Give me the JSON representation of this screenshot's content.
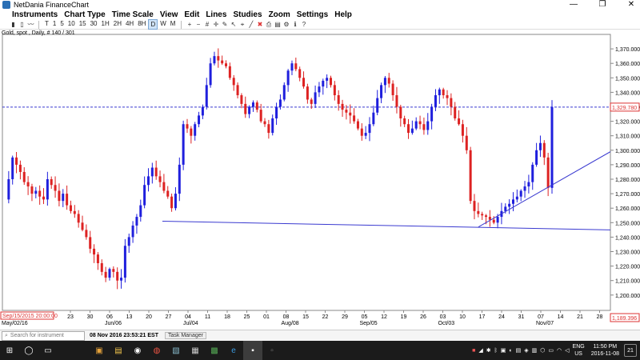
{
  "window": {
    "title": "NetDania FinanceChart",
    "controls": [
      "—",
      "❐",
      "✕"
    ]
  },
  "menu": [
    "Instruments",
    "Chart Type",
    "Time Scale",
    "View",
    "Edit",
    "Lines",
    "Studies",
    "Zoom",
    "Settings",
    "Help"
  ],
  "toolbar": {
    "periods": [
      "T",
      "1",
      "5",
      "10",
      "15",
      "30",
      "1H",
      "2H",
      "4H",
      "8H",
      "D",
      "W",
      "M"
    ],
    "active_period": "D"
  },
  "chart_label": "Gold, spot , Daily, # 140 / 301",
  "current_price_label": "1,329.780",
  "bottom_price_label": "1,189.396",
  "cursor_date_label": "Sep/15/2015 20:00:00",
  "colors": {
    "up": "#1f1fdd",
    "down": "#dd2222",
    "line": "#3a3ad0",
    "accent": "#2a6fb5"
  },
  "chart_data": {
    "type": "candlestick",
    "symbol": "Gold, spot",
    "timeframe": "Daily",
    "ylim": [
      1189.396,
      1380
    ],
    "y_ticks": [
      1200,
      1210,
      1220,
      1230,
      1240,
      1250,
      1260,
      1270,
      1280,
      1290,
      1300,
      1310,
      1320,
      1330,
      1340,
      1350,
      1360,
      1370
    ],
    "y_tick_labels": [
      "1,200.000",
      "1,210.000",
      "1,220.000",
      "1,230.000",
      "1,240.000",
      "1,250.000",
      "1,260.000",
      "1,270.000",
      "1,280.000",
      "1,290.000",
      "1,300.000",
      "1,310.000",
      "1,320.000",
      "1,330.000",
      "1,340.000",
      "1,350.000",
      "1,360.000",
      "1,370.000"
    ],
    "x_ticks": [
      "23",
      "30",
      "06",
      "13",
      "20",
      "27",
      "04",
      "11",
      "18",
      "25",
      "01",
      "08",
      "15",
      "22",
      "29",
      "05",
      "12",
      "19",
      "26",
      "03",
      "10",
      "17",
      "24",
      "31",
      "07",
      "14",
      "21",
      "28"
    ],
    "month_labels": [
      {
        "text": "May/02/16",
        "tick_index": 0
      },
      {
        "text": "Jun/06",
        "tick_index": 2
      },
      {
        "text": "Jul/04",
        "tick_index": 6
      },
      {
        "text": "Aug/08",
        "tick_index": 11
      },
      {
        "text": "Sep/05",
        "tick_index": 15
      },
      {
        "text": "Oct/03",
        "tick_index": 19
      },
      {
        "text": "Nov/07",
        "tick_index": 24
      }
    ],
    "current_price": 1329.78,
    "price_series": [
      1266,
      1280,
      1295,
      1290,
      1285,
      1278,
      1275,
      1270,
      1272,
      1268,
      1266,
      1280,
      1276,
      1272,
      1265,
      1270,
      1262,
      1258,
      1256,
      1250,
      1245,
      1240,
      1232,
      1228,
      1222,
      1216,
      1212,
      1218,
      1216,
      1210,
      1212,
      1234,
      1240,
      1248,
      1254,
      1262,
      1276,
      1282,
      1288,
      1282,
      1278,
      1272,
      1268,
      1260,
      1270,
      1290,
      1318,
      1315,
      1310,
      1318,
      1324,
      1330,
      1345,
      1360,
      1365,
      1362,
      1360,
      1358,
      1350,
      1345,
      1338,
      1332,
      1325,
      1330,
      1333,
      1328,
      1320,
      1318,
      1312,
      1322,
      1330,
      1335,
      1345,
      1355,
      1360,
      1356,
      1350,
      1344,
      1335,
      1332,
      1340,
      1344,
      1348,
      1350,
      1345,
      1338,
      1332,
      1328,
      1326,
      1324,
      1320,
      1315,
      1310,
      1312,
      1318,
      1326,
      1336,
      1345,
      1350,
      1346,
      1338,
      1330,
      1322,
      1318,
      1312,
      1315,
      1320,
      1318,
      1314,
      1320,
      1330,
      1338,
      1342,
      1338,
      1336,
      1330,
      1322,
      1318,
      1310,
      1300,
      1265,
      1258,
      1256,
      1255,
      1254,
      1252,
      1250,
      1254,
      1258,
      1261,
      1263,
      1266,
      1268,
      1272,
      1275,
      1278,
      1290,
      1300,
      1305,
      1295,
      1274,
      1329.78
    ],
    "trendlines": [
      {
        "name": "support",
        "points": [
          [
            "Jun/27",
            1251
          ],
          [
            "Nov/28",
            1245
          ]
        ]
      },
      {
        "name": "rising",
        "points": [
          [
            "Oct/14",
            1247
          ],
          [
            "Nov/28",
            1299
          ]
        ]
      }
    ]
  },
  "statusbar": {
    "search_placeholder": "Search for instrument",
    "timestamp": "08 Nov 2016 23:53:21 EST",
    "task_label": "Task Manager"
  },
  "taskbar": {
    "lang_top": "ENG",
    "lang_bottom": "US",
    "time": "11:50 PM",
    "date": "2016-11-08",
    "notif_count": "21"
  }
}
